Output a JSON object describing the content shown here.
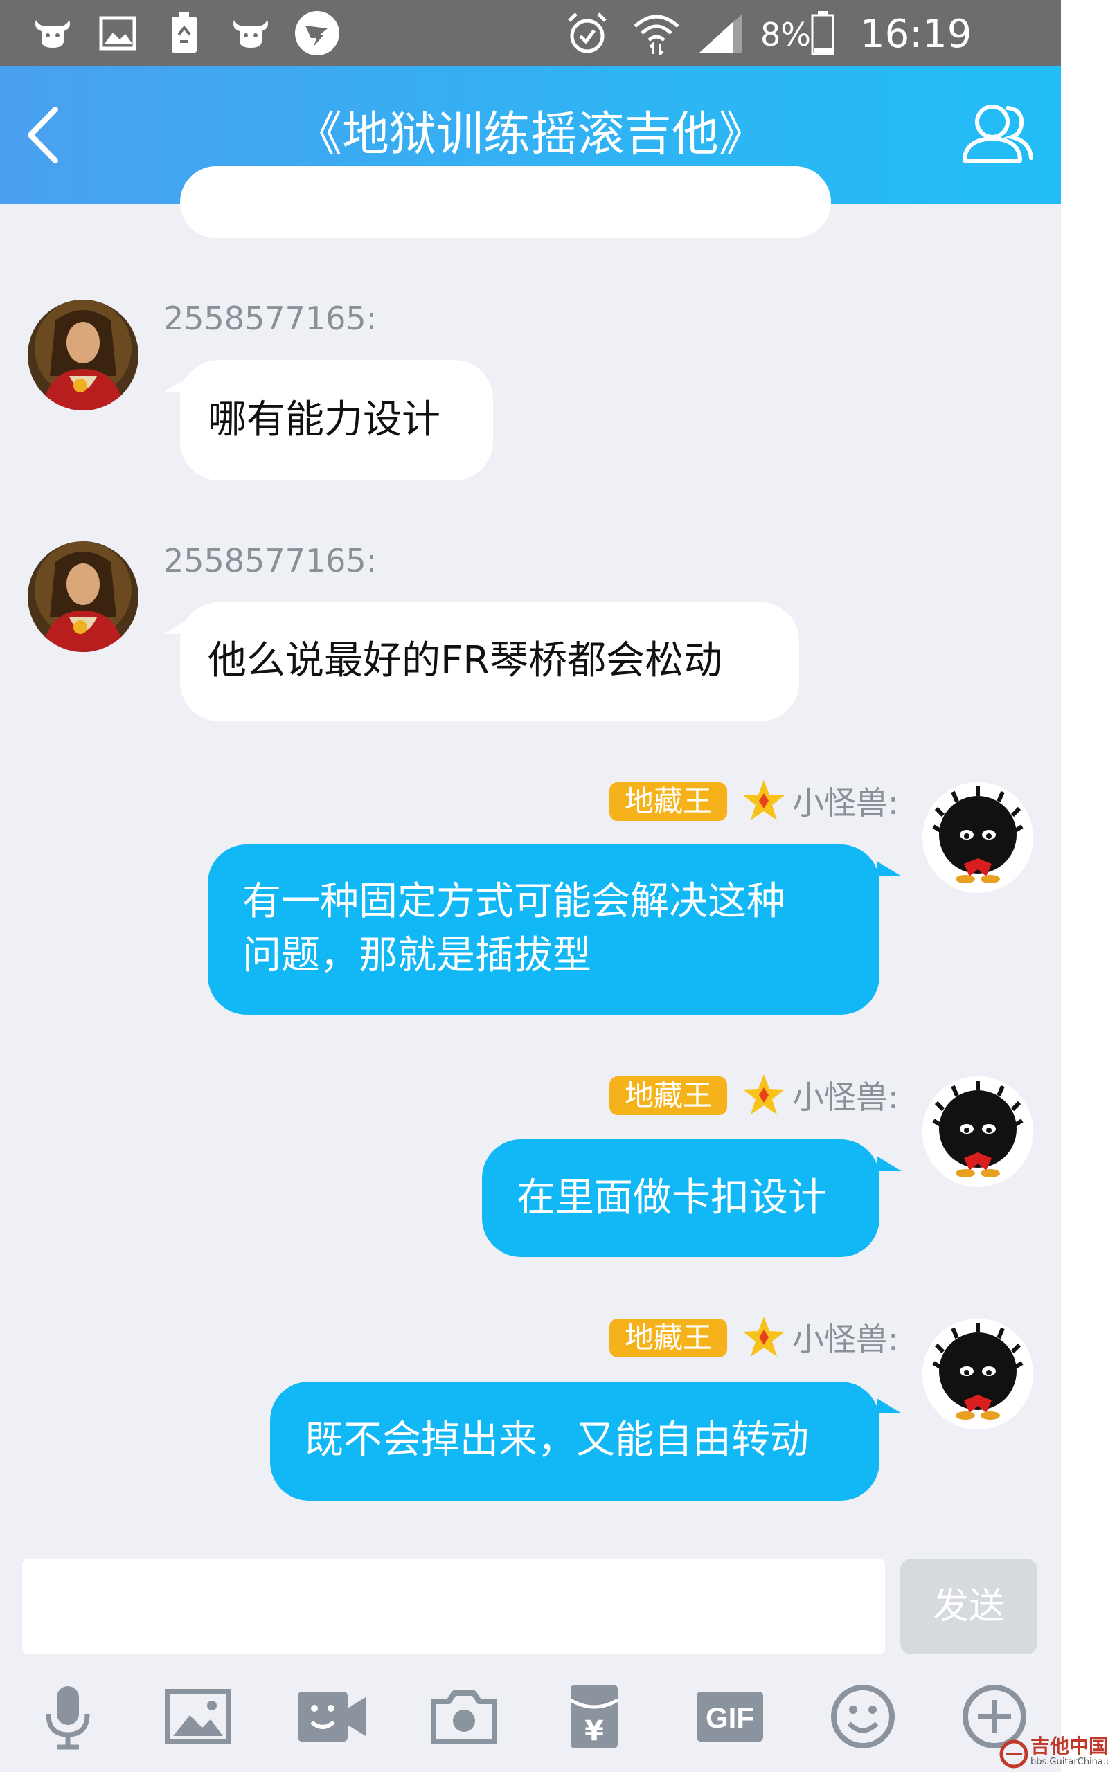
{
  "status_bar": {
    "battery_percent": "8%",
    "time": "16:19",
    "icons": [
      "bull-icon",
      "image-icon",
      "recycle-battery-icon",
      "bull-icon",
      "dingtalk-icon",
      "alarm-icon",
      "wifi-icon",
      "signal-icon",
      "battery-icon"
    ]
  },
  "header": {
    "title": "《地狱训练摇滚吉他》",
    "back_icon": "chevron-left-icon",
    "group_icon": "group-members-icon"
  },
  "messages": [
    {
      "side": "in",
      "sender": "2558577165:",
      "text": "哪有能力设计"
    },
    {
      "side": "in",
      "sender": "2558577165:",
      "text": "他么说最好的FR琴桥都会松动"
    },
    {
      "side": "out",
      "badge": "地藏王",
      "nick": "小怪兽:",
      "text_lines": [
        "有一种固定方式可能会解决这种",
        "问题，那就是插拔型"
      ]
    },
    {
      "side": "out",
      "badge": "地藏王",
      "nick": "小怪兽:",
      "text": "在里面做卡扣设计"
    },
    {
      "side": "out",
      "badge": "地藏王",
      "nick": "小怪兽:",
      "text": "既不会掉出来，又能自由转动"
    }
  ],
  "composer": {
    "input_value": "",
    "send_label": "发送"
  },
  "toolbar": {
    "items": [
      "microphone-icon",
      "image-icon",
      "video-call-icon",
      "camera-icon",
      "red-packet-icon",
      "gif-icon",
      "emoji-icon",
      "plus-icon"
    ],
    "gif_label": "GIF",
    "red_packet_symbol": "¥"
  },
  "watermark": {
    "text": "吉他中国",
    "sub": "bbs.GuitarChina.com"
  },
  "colors": {
    "header_start": "#4aa0f0",
    "header_end": "#22bdf6",
    "outgoing_bubble": "#12b7f5",
    "incoming_bubble": "#ffffff",
    "badge": "#f6b21b",
    "background": "#eef0f5"
  }
}
